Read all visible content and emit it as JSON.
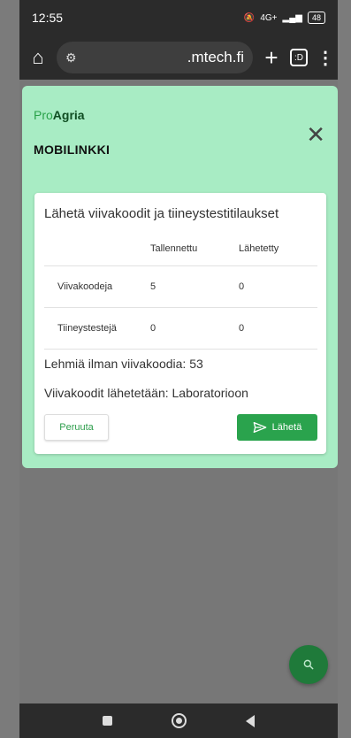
{
  "status_bar": {
    "time": "12:55",
    "network": "4G+",
    "battery": "48"
  },
  "browser": {
    "url": ".mtech.fi",
    "tab_count": ":D",
    "plus": "+",
    "menu": "⋮"
  },
  "dialog": {
    "logo_pro": "Pro",
    "logo_agria": "Agria",
    "app_title": "MOBILINKKI",
    "close": "✕",
    "card": {
      "title": "Lähetä viivakoodit ja tiineystestitilaukset",
      "columns": [
        "",
        "Tallennettu",
        "Lähetetty"
      ],
      "rows": [
        {
          "label": "Viivakoodeja",
          "saved": "5",
          "sent": "0"
        },
        {
          "label": "Tiineystestejä",
          "saved": "0",
          "sent": "0"
        }
      ],
      "no_barcode_text": "Lehmiä ilman viivakoodia: 53",
      "sent_to_text": "Viivakoodit lähetetään: Laboratorioon",
      "cancel_label": "Peruuta",
      "send_label": "Lähetä"
    }
  },
  "colors": {
    "dialog_bg": "#a8ecc4",
    "accent_green": "#2aa34d",
    "fab_green": "#1f7a3a"
  },
  "icons": {
    "home": "home-icon",
    "tune": "tune-icon",
    "send": "send-icon",
    "search": "search-icon"
  }
}
